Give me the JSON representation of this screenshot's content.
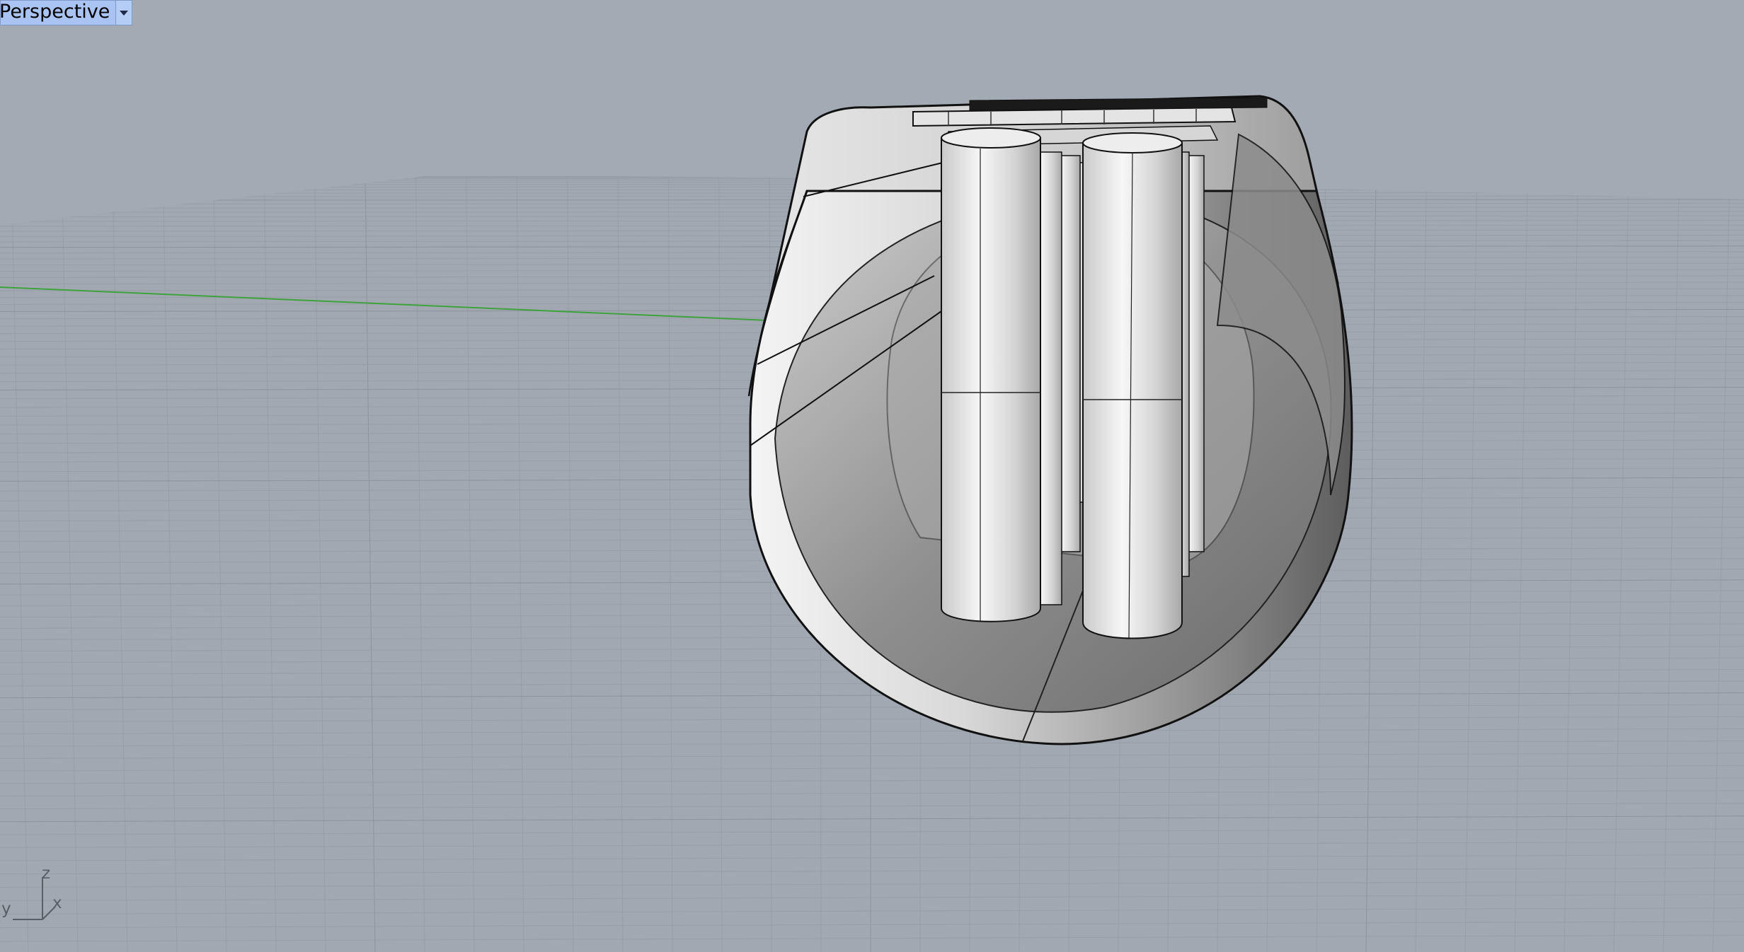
{
  "viewport": {
    "title": "Perspective",
    "menu_icon": "chevron-down-icon"
  },
  "axis_widget": {
    "z_label": "z",
    "x_label": "x",
    "y_label": "y"
  },
  "colors": {
    "background": "#a4aab3",
    "grid_minor": "#99a0a9",
    "grid_major": "#8c939c",
    "x_axis_line": "#3ea23e",
    "tab_background": "#a9c4f2"
  }
}
